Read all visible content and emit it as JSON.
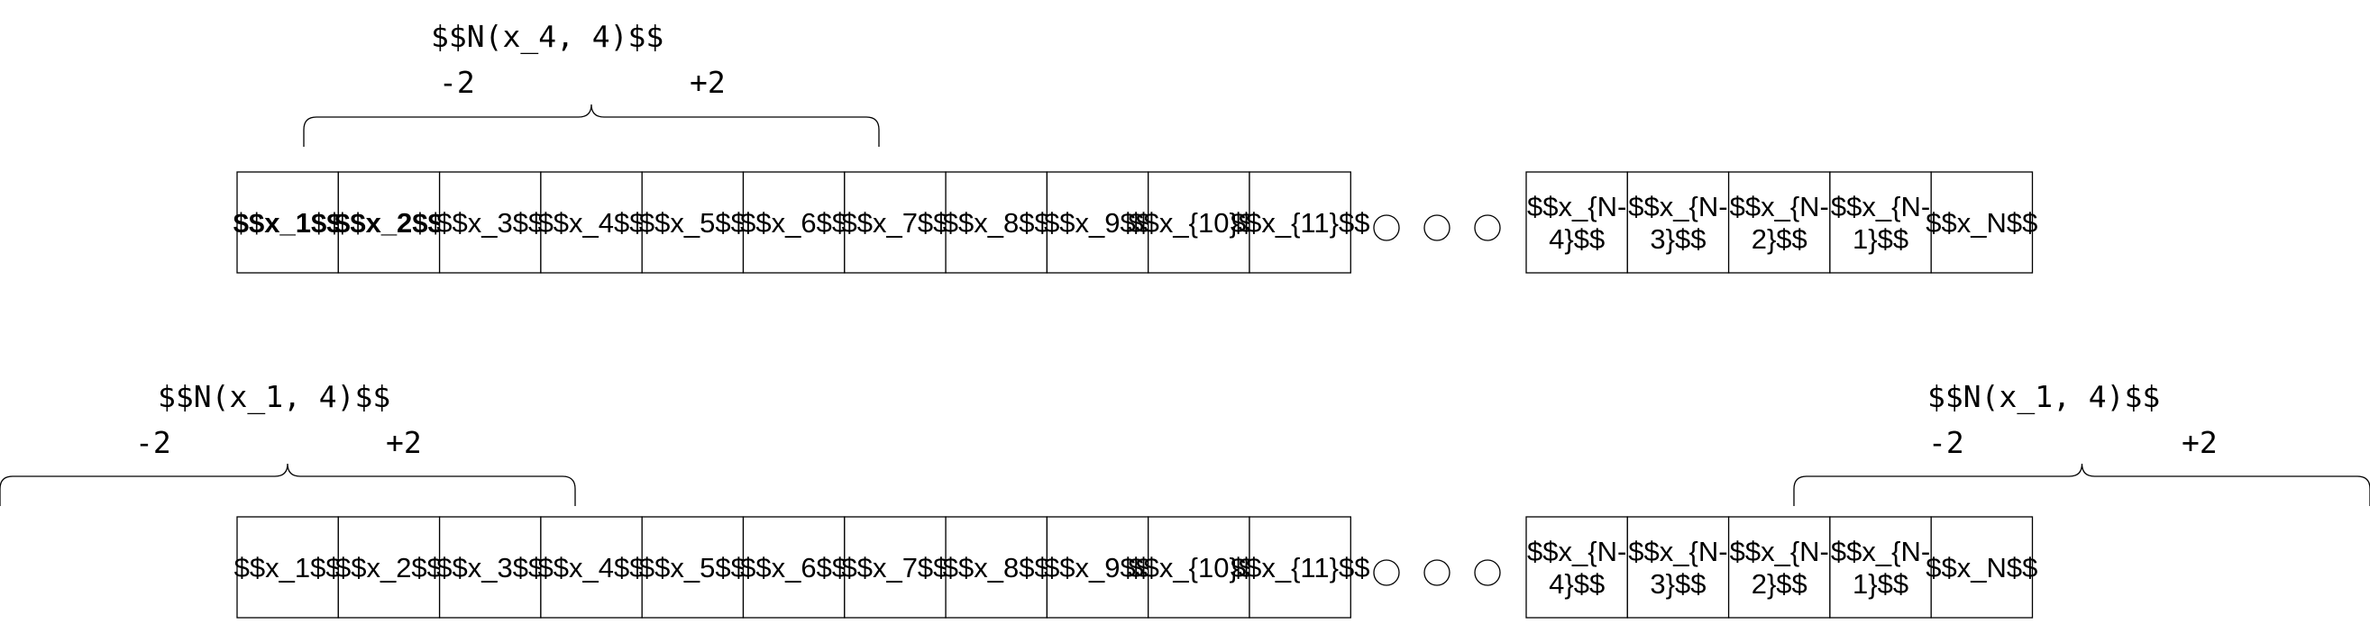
{
  "rows": [
    {
      "cells": [
        {
          "text": "$$x_1$$",
          "bold": true
        },
        {
          "text": "$$x_2$$",
          "bold": true
        },
        {
          "text": "$$x_3$$"
        },
        {
          "text": "$$x_4$$"
        },
        {
          "text": "$$x_5$$"
        },
        {
          "text": "$$x_6$$"
        },
        {
          "text": "$$x_7$$"
        },
        {
          "text": "$$x_8$$"
        },
        {
          "text": "$$x_9$$"
        },
        {
          "text": "$$x_{10}$$"
        },
        {
          "text": "$$x_{11}$$"
        }
      ],
      "tail_cells": [
        {
          "lines": [
            "$$x_{N-",
            "4}$$"
          ]
        },
        {
          "lines": [
            "$$x_{N-",
            "3}$$"
          ]
        },
        {
          "lines": [
            "$$x_{N-",
            "2}$$"
          ]
        },
        {
          "lines": [
            "$$x_{N-",
            "1}$$"
          ]
        },
        {
          "lines": [
            "$$x_N$$"
          ]
        }
      ]
    },
    {
      "cells": [
        {
          "text": "$$x_1$$"
        },
        {
          "text": "$$x_2$$"
        },
        {
          "text": "$$x_3$$"
        },
        {
          "text": "$$x_4$$"
        },
        {
          "text": "$$x_5$$"
        },
        {
          "text": "$$x_6$$"
        },
        {
          "text": "$$x_7$$"
        },
        {
          "text": "$$x_8$$"
        },
        {
          "text": "$$x_9$$"
        },
        {
          "text": "$$x_{10}$$"
        },
        {
          "text": "$$x_{11}$$"
        }
      ],
      "tail_cells": [
        {
          "lines": [
            "$$x_{N-",
            "4}$$"
          ]
        },
        {
          "lines": [
            "$$x_{N-",
            "3}$$"
          ]
        },
        {
          "lines": [
            "$$x_{N-",
            "2}$$"
          ]
        },
        {
          "lines": [
            "$$x_{N-",
            "1}$$"
          ]
        },
        {
          "lines": [
            "$$x_N$$"
          ]
        }
      ]
    }
  ],
  "neighborhoods": [
    {
      "label": "$$N(x_4, 4)$$",
      "minus": "-2",
      "plus": "+2"
    },
    {
      "label": "$$N(x_1, 4)$$",
      "minus": "-2",
      "plus": "+2"
    },
    {
      "label": "$$N(x_1, 4)$$",
      "minus": "-2",
      "plus": "+2"
    }
  ]
}
